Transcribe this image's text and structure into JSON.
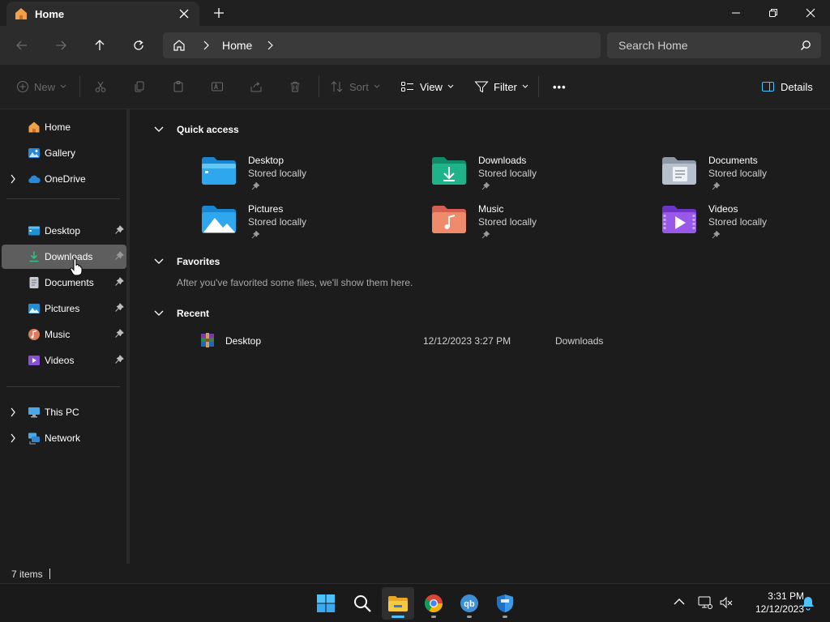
{
  "window": {
    "tab_title": "Home",
    "new_tab": "+"
  },
  "navbar": {
    "breadcrumb": "Home",
    "search_placeholder": "Search Home"
  },
  "commands": {
    "new": "New",
    "sort": "Sort",
    "view": "View",
    "filter": "Filter",
    "more": "•••",
    "details": "Details"
  },
  "sidebar": {
    "top": [
      {
        "label": "Home"
      },
      {
        "label": "Gallery"
      },
      {
        "label": "OneDrive"
      }
    ],
    "pinned": [
      {
        "label": "Desktop"
      },
      {
        "label": "Downloads"
      },
      {
        "label": "Documents"
      },
      {
        "label": "Pictures"
      },
      {
        "label": "Music"
      },
      {
        "label": "Videos"
      }
    ],
    "bottom": [
      {
        "label": "This PC"
      },
      {
        "label": "Network"
      }
    ]
  },
  "main": {
    "quick_access": {
      "title": "Quick access",
      "items": [
        {
          "name": "Desktop",
          "sub": "Stored locally"
        },
        {
          "name": "Downloads",
          "sub": "Stored locally"
        },
        {
          "name": "Documents",
          "sub": "Stored locally"
        },
        {
          "name": "Pictures",
          "sub": "Stored locally"
        },
        {
          "name": "Music",
          "sub": "Stored locally"
        },
        {
          "name": "Videos",
          "sub": "Stored locally"
        }
      ]
    },
    "favorites": {
      "title": "Favorites",
      "empty_message": "After you've favorited some files, we'll show them here."
    },
    "recent": {
      "title": "Recent",
      "items": [
        {
          "name": "Desktop",
          "date": "12/12/2023 3:27 PM",
          "location": "Downloads"
        }
      ]
    }
  },
  "status": {
    "item_count": "7 items"
  },
  "taskbar": {
    "time": "3:31 PM",
    "date": "12/12/2023"
  },
  "colors": {
    "accent": "#4cc2ff",
    "selected_row": "#5e5e5e"
  }
}
